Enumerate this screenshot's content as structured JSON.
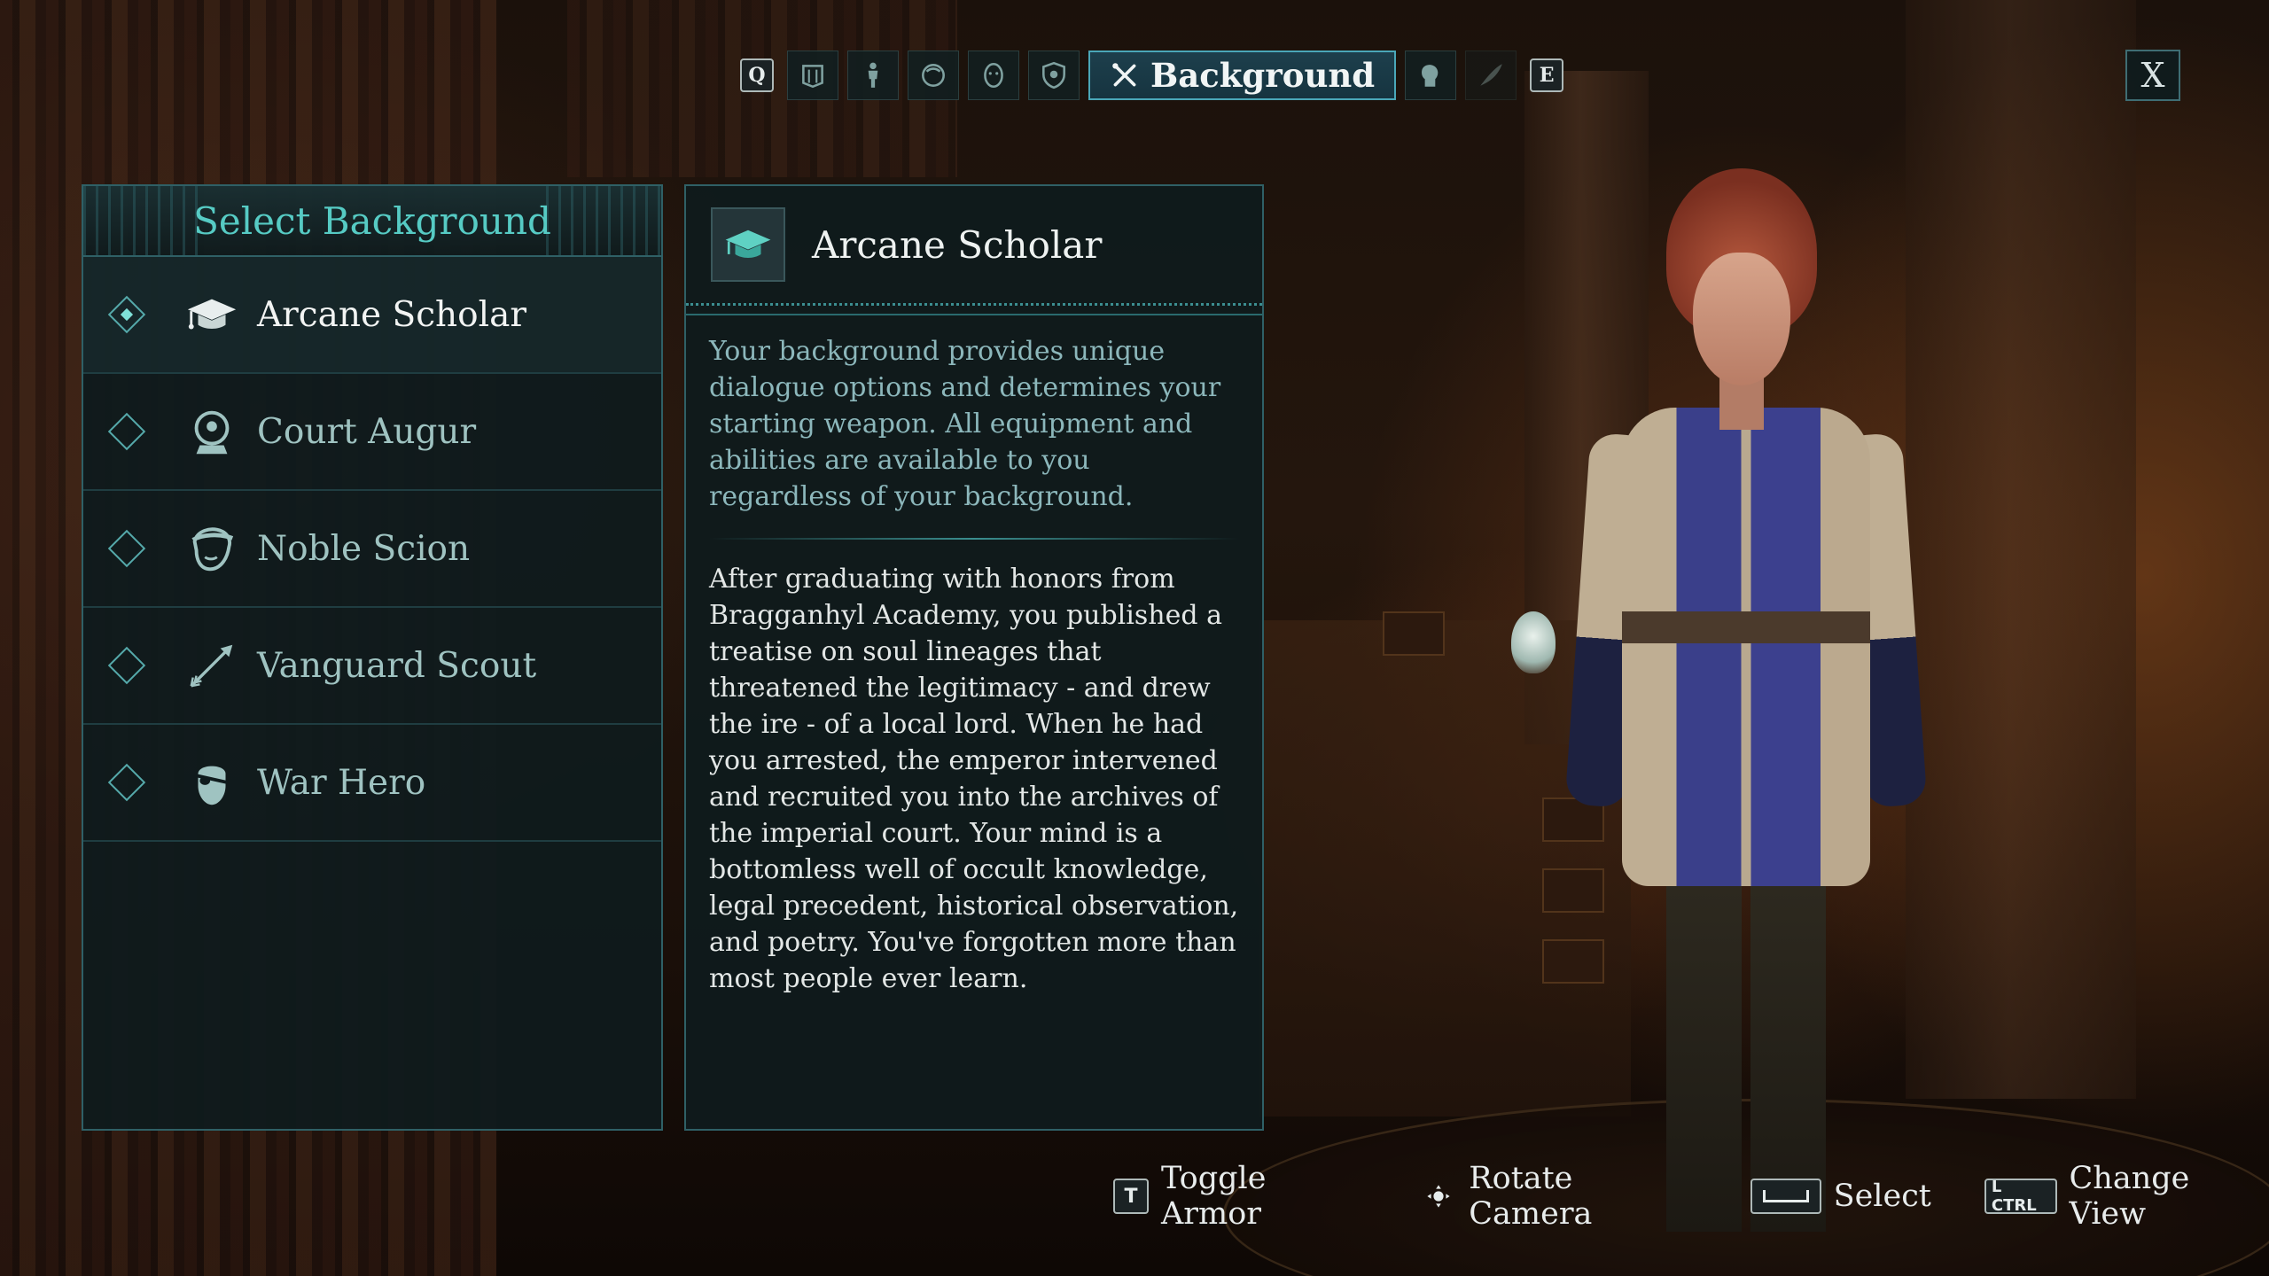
{
  "top_tabs": {
    "prev_key": "Q",
    "next_key": "E",
    "items": [
      {
        "icon": "faction-icon",
        "active": false
      },
      {
        "icon": "body-icon",
        "active": false
      },
      {
        "icon": "head-icon",
        "active": false
      },
      {
        "icon": "face-icon",
        "active": false
      },
      {
        "icon": "shield-icon",
        "active": false
      },
      {
        "icon": "crossed-tools-icon",
        "label": "Background",
        "active": true
      },
      {
        "icon": "portrait-icon",
        "active": false
      },
      {
        "icon": "quill-icon",
        "active": false,
        "disabled": true
      }
    ]
  },
  "close_label": "X",
  "list": {
    "title": "Select Background",
    "items": [
      {
        "label": "Arcane Scholar",
        "icon": "graduation-cap-icon",
        "selected": true
      },
      {
        "label": "Court Augur",
        "icon": "crystal-ball-icon",
        "selected": false
      },
      {
        "label": "Noble Scion",
        "icon": "noble-face-icon",
        "selected": false
      },
      {
        "label": "Vanguard Scout",
        "icon": "arrow-icon",
        "selected": false
      },
      {
        "label": "War Hero",
        "icon": "eyepatch-face-icon",
        "selected": false
      }
    ]
  },
  "detail": {
    "title": "Arcane Scholar",
    "icon": "graduation-cap-icon",
    "intro": "Your background provides unique dialogue options and determines your starting weapon. All equipment and abilities are available to you regardless of your background.",
    "body": "After graduating with honors from Bragganhyl Academy, you published a treatise on soul lineages that threatened the legitimacy - and drew the ire - of a local lord. When he had you arrested, the emperor intervened and recruited you into the archives of the imperial court. Your mind is a bottomless well of occult knowledge, legal precedent, historical observation, and poetry. You've forgotten more than most people ever learn."
  },
  "hints": [
    {
      "key": "T",
      "label": "Toggle Armor"
    },
    {
      "key": "",
      "key_icon": "right-stick-icon",
      "label": "Rotate Camera"
    },
    {
      "key": "",
      "key_icon": "spacebar-icon",
      "label": "Select"
    },
    {
      "key": "L CTRL",
      "label": "Change View"
    }
  ],
  "colors": {
    "accent": "#56cbc4",
    "panel_border": "#2f6066",
    "active_tab": "#1d3f4c",
    "intro_text": "#8cb7bb"
  }
}
